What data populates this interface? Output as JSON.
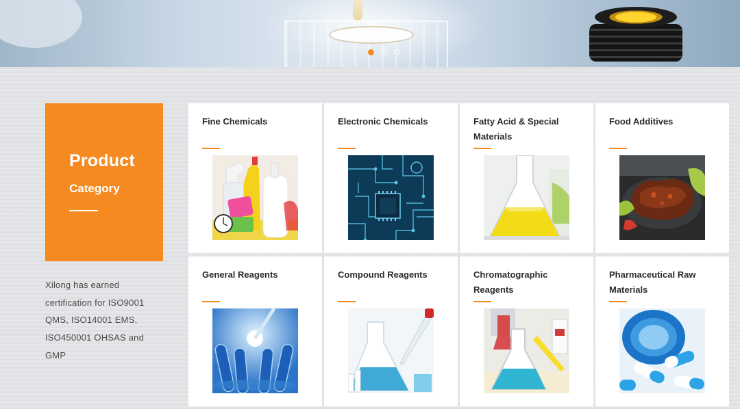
{
  "banner": {
    "slides": 3,
    "active_slide": 1
  },
  "category": {
    "title": "Product",
    "subtitle": "Category"
  },
  "certification_text": "Xilong has earned certification for ISO9001 QMS, ISO14001 EMS, ISO450001 OHSAS and GMP",
  "colors": {
    "accent": "#f58a20"
  },
  "products": [
    {
      "title": "Fine Chemicals",
      "image": "cleaning-products-image"
    },
    {
      "title": "Electronic Chemicals",
      "image": "circuit-board-image"
    },
    {
      "title": "Fatty Acid & Special Materials",
      "image": "yellow-flask-image"
    },
    {
      "title": "Food Additives",
      "image": "grilled-meat-image"
    },
    {
      "title": "General Reagents",
      "image": "blue-test-tubes-image"
    },
    {
      "title": "Compound Reagents",
      "image": "pipette-flask-image"
    },
    {
      "title": "Chromatographic Reagents",
      "image": "lab-flasks-image"
    },
    {
      "title": "Pharmaceutical Raw Materials",
      "image": "capsules-image"
    }
  ]
}
